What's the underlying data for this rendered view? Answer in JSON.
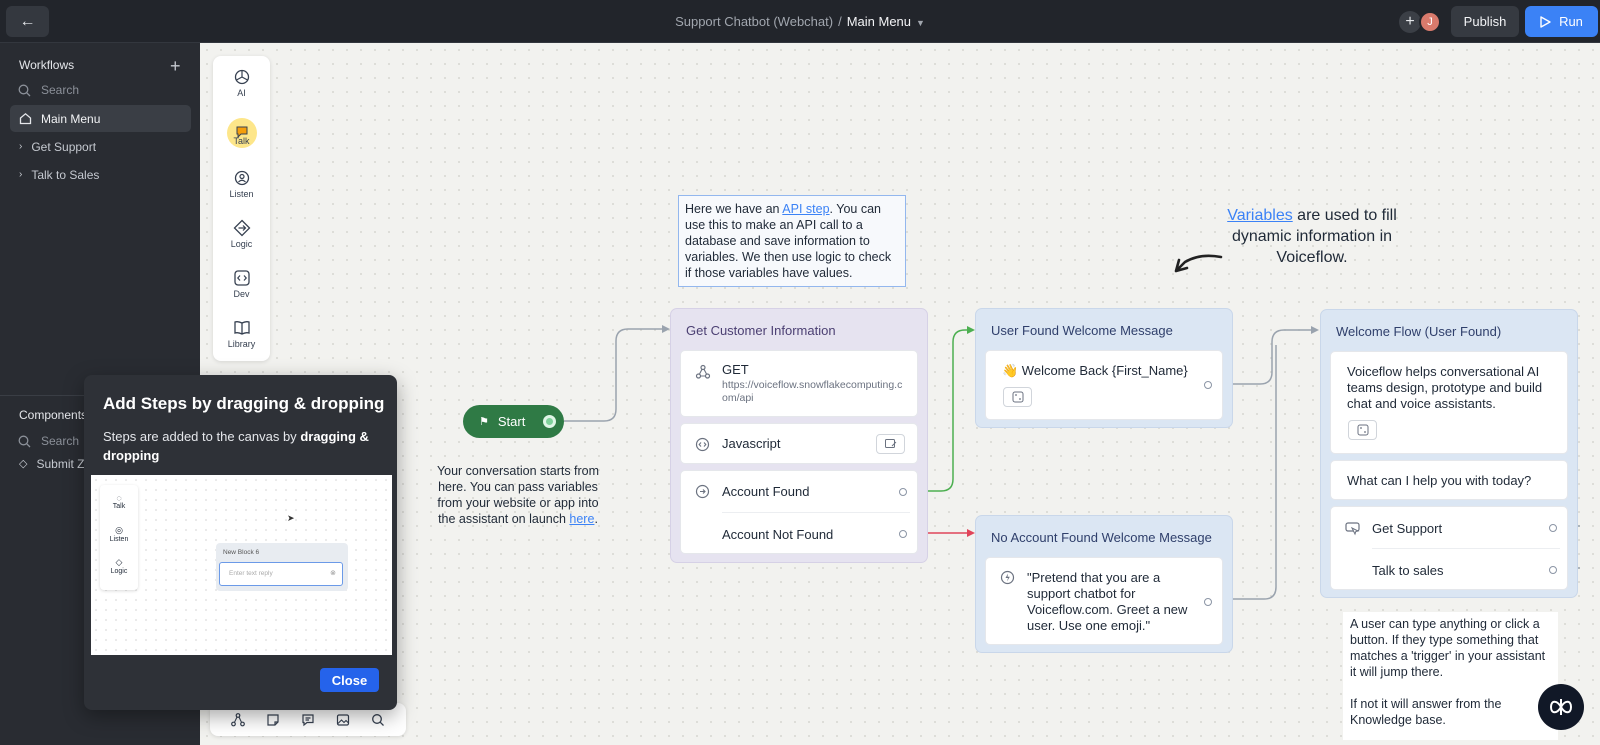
{
  "topbar": {
    "project": "Support Chatbot (Webchat)",
    "separator": "/",
    "current": "Main Menu",
    "avatar_initial": "J",
    "publish_label": "Publish",
    "run_label": "Run"
  },
  "sidebar": {
    "workflows_title": "Workflows",
    "search_placeholder": "Search",
    "items": [
      {
        "label": "Main Menu",
        "icon": "home-icon"
      },
      {
        "label": "Get Support",
        "icon": "chevron-right-icon"
      },
      {
        "label": "Talk to Sales",
        "icon": "chevron-right-icon"
      }
    ],
    "components_title": "Components",
    "components_search": "Search",
    "components_items": [
      {
        "label": "Submit Z"
      }
    ]
  },
  "steps": [
    {
      "label": "AI",
      "icon": "openai-icon"
    },
    {
      "label": "Talk",
      "icon": "talk-icon"
    },
    {
      "label": "Listen",
      "icon": "listen-icon"
    },
    {
      "label": "Logic",
      "icon": "logic-icon"
    },
    {
      "label": "Dev",
      "icon": "dev-icon"
    },
    {
      "label": "Library",
      "icon": "library-icon"
    }
  ],
  "canvas": {
    "start_label": "Start",
    "start_note": {
      "text": "Your conversation starts from here. You can pass variables from your website or app into the assistant on launch ",
      "link": "here",
      "end": "."
    },
    "api_note": {
      "pre": "Here we have an ",
      "link": "API step",
      "post": ". You can use this to make an API call to a database and save information to variables. We then use logic to check if those variables have values."
    },
    "variables_note": {
      "link": "Variables",
      "text": " are used to fill dynamic information in Voiceflow."
    },
    "customer_block": {
      "title": "Get Customer Information",
      "api_method": "GET",
      "api_url": "https://voiceflow.snowflakecomputing.com/api",
      "js_label": "Javascript",
      "path_found": "Account Found",
      "path_not_found": "Account Not Found"
    },
    "found_block": {
      "title": "User Found Welcome Message",
      "text": "👋 Welcome Back {First_Name}"
    },
    "notfound_block": {
      "title": "No Account Found Welcome Message",
      "text": "\"Pretend that you are a support chatbot for Voiceflow.com. Greet a new user. Use one emoji.\""
    },
    "welcome_flow": {
      "title": "Welcome Flow (User Found)",
      "intro": "Voiceflow helps conversational AI teams design, prototype and build chat and voice assistants.",
      "question": "What can I help you with today?",
      "buttons": [
        "Get Support",
        "Talk to sales"
      ]
    },
    "bottom_note": "A user can type anything or click a button. If they type something that matches a 'trigger' in your assistant it will jump there.",
    "bottom_note_2": "If not it will answer from the Knowledge base."
  },
  "popup": {
    "title": "Add Steps by dragging & dropping",
    "text_pre": "Steps are added to the canvas by ",
    "text_bold": "dragging & dropping",
    "preview": {
      "steps": [
        "Talk",
        "Listen",
        "Logic"
      ],
      "block_title": "New Block 6",
      "input_placeholder": "Enter text reply"
    },
    "close_label": "Close"
  },
  "colors": {
    "accent": "#3b82f6",
    "start": "#2f7a45",
    "path_found": "#4caf50",
    "path_not_found": "#e0445a"
  }
}
